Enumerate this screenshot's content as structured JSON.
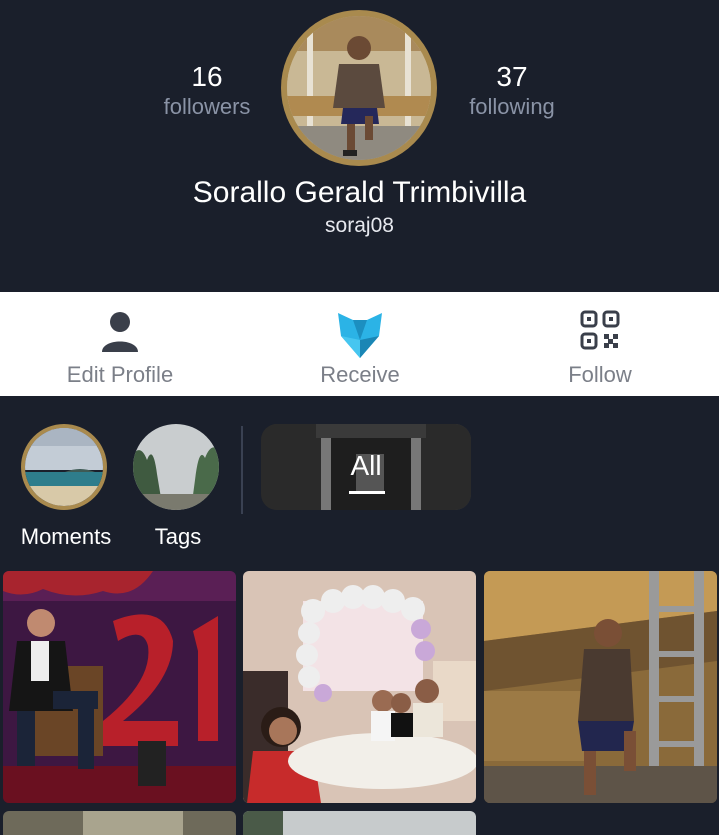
{
  "profile": {
    "followers_count": "16",
    "followers_label": "followers",
    "following_count": "37",
    "following_label": "following",
    "name": "Sorallo Gerald Trimbivilla",
    "handle": "soraj08"
  },
  "actions": {
    "edit_profile": "Edit Profile",
    "receive": "Receive",
    "follow": "Follow"
  },
  "stories": {
    "moments": "Moments",
    "tags": "Tags",
    "all": "All"
  },
  "colors": {
    "background": "#1a1f2b",
    "avatar_ring": "#a98a4e",
    "muted_text": "#8a93a6",
    "action_bar": "#ffffff",
    "receive_icon": "#2bb3e6"
  }
}
